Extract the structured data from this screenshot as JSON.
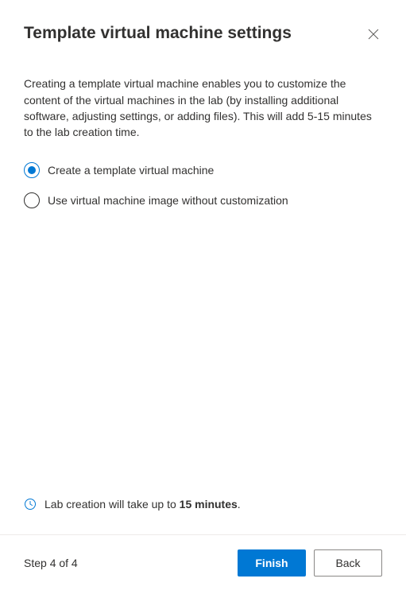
{
  "header": {
    "title": "Template virtual machine settings"
  },
  "description": "Creating a template virtual machine enables you to customize the content of the virtual machines in the lab (by installing additional software, adjusting settings, or adding files). This will add 5-15 minutes to the lab creation time.",
  "options": {
    "create": "Create a template virtual machine",
    "use_image": "Use virtual machine image without customization",
    "selected": "create"
  },
  "info": {
    "prefix": "Lab creation will take up to ",
    "bold": "15 minutes",
    "suffix": "."
  },
  "footer": {
    "step": "Step 4 of 4",
    "finish": "Finish",
    "back": "Back"
  },
  "colors": {
    "primary": "#0078d4"
  }
}
